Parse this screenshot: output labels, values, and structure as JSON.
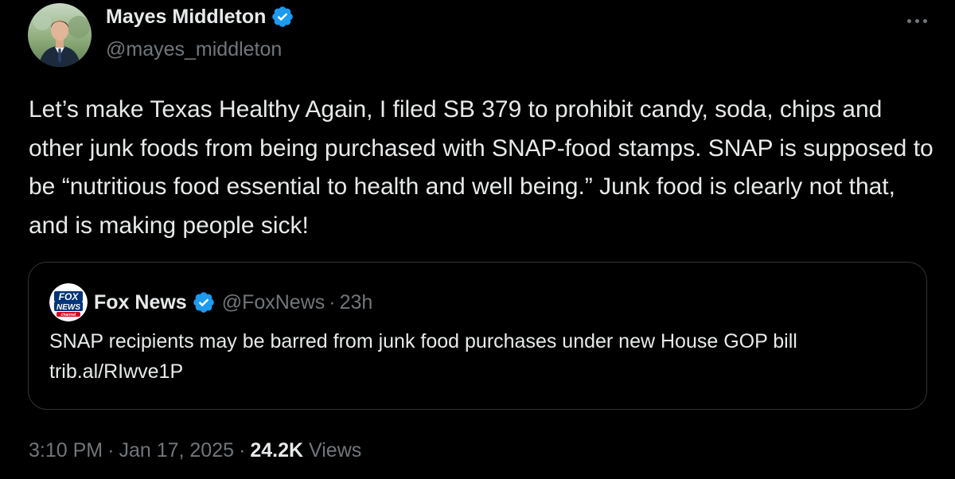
{
  "author": {
    "name": "Mayes Middleton",
    "handle": "@mayes_middleton",
    "avatar_icon": "person-avatar-icon",
    "verified_icon": "verified-badge-icon"
  },
  "tweet": {
    "text": "Let’s make Texas Healthy Again, I filed SB 379 to prohibit candy, soda, chips and other junk foods from being purchased with SNAP-food stamps. SNAP is supposed to be “nutritious food essential to health and well being.” Junk food is clearly not that, and is making people sick!"
  },
  "quote": {
    "name": "Fox News",
    "handle": "@FoxNews",
    "separator": "·",
    "time": "23h",
    "text": "SNAP recipients may be barred from junk food purchases under new House GOP bill trib.al/RIwve1P",
    "logo_icon": "fox-news-logo-icon",
    "logo_lines": [
      "FOX",
      "NEWS",
      "channel"
    ]
  },
  "meta": {
    "time": "3:10 PM",
    "date": "Jan 17, 2025",
    "separator": "·",
    "views_count": "24.2K",
    "views_label": "Views"
  },
  "colors": {
    "background": "#000000",
    "text_primary": "#e7e9ea",
    "text_secondary": "#71767b",
    "verified_blue": "#1d9bf0",
    "border": "#2f3336",
    "fox_blue": "#00347a",
    "fox_red": "#d6001c"
  }
}
